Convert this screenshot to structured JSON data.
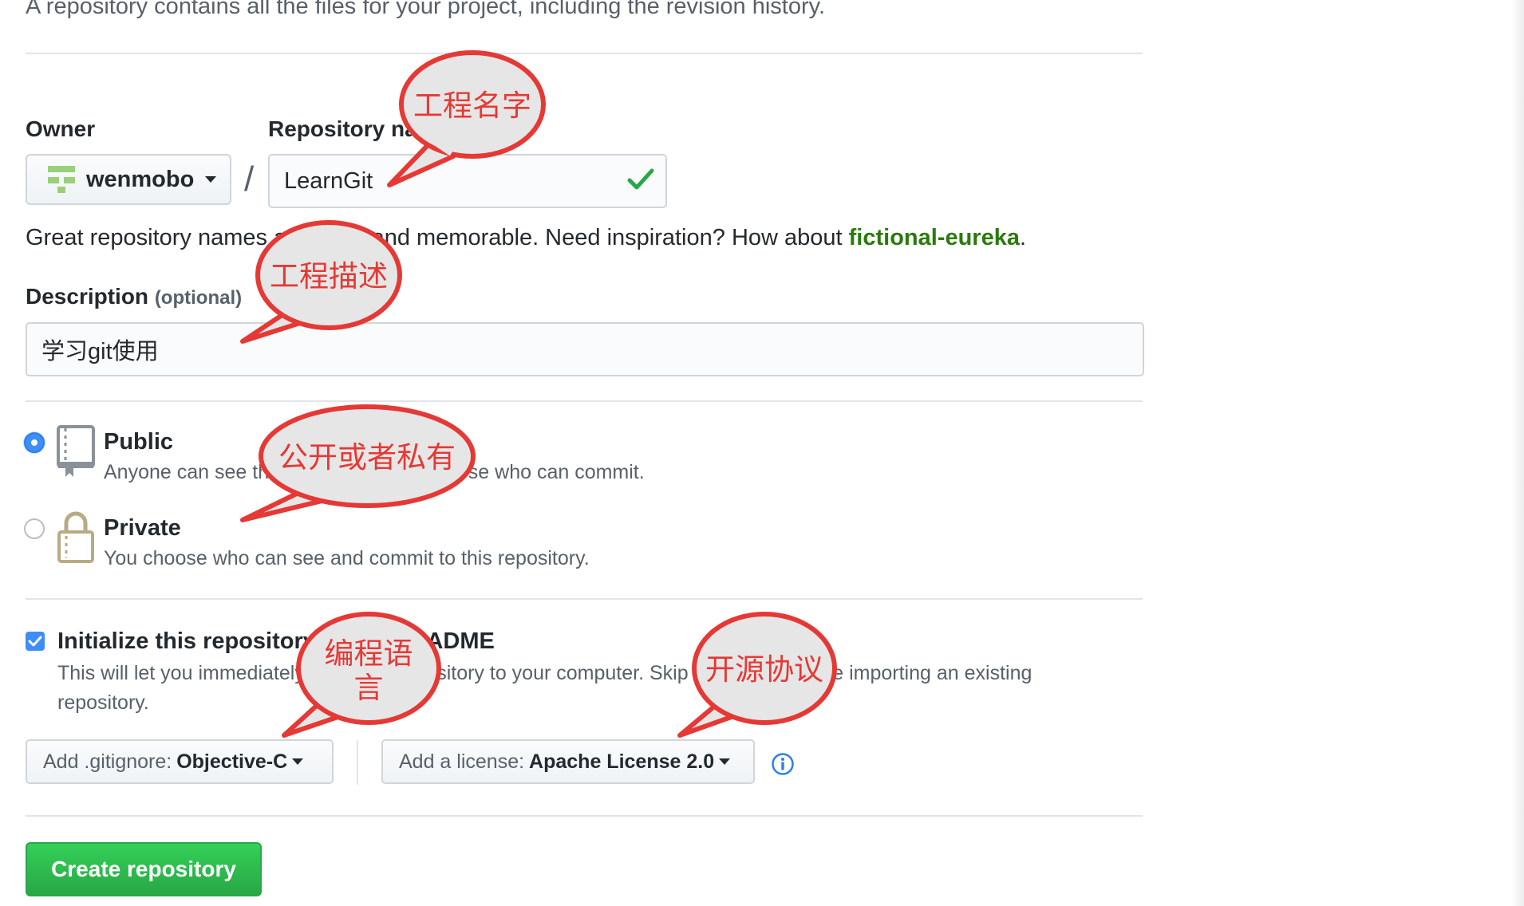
{
  "intro": "A repository contains all the files for your project, including the revision history.",
  "owner": {
    "label": "Owner",
    "name": "wenmobo"
  },
  "repo": {
    "label": "Repository name",
    "value": "LearnGit",
    "valid_icon": "check-icon"
  },
  "hint": {
    "prefix": "Great repository names are short and memorable. Need inspiration? How about ",
    "suggestion": "fictional-eureka",
    "suffix": "."
  },
  "description": {
    "label": "Description",
    "optional": "(optional)",
    "value": "学习git使用"
  },
  "visibility": {
    "public": {
      "title": "Public",
      "sub": "Anyone can see this repository. You choose who can commit.",
      "checked": true
    },
    "private": {
      "title": "Private",
      "sub": "You choose who can see and commit to this repository.",
      "checked": false
    }
  },
  "init": {
    "title": "Initialize this repository with a README",
    "sub": "This will let you immediately clone the repository to your computer. Skip this step if you’re importing an existing repository.",
    "checked": true
  },
  "gitignore": {
    "prefix": "Add .gitignore:",
    "value": "Objective-C"
  },
  "license": {
    "prefix": "Add a license:",
    "value": "Apache License 2.0"
  },
  "create_button": "Create repository",
  "callouts": {
    "repo_name": "工程名字",
    "description": "工程描述",
    "visibility": "公开或者私有",
    "language_line1": "编程语",
    "language_line2": "言",
    "license": "开源协议"
  },
  "colors": {
    "accent": "#2b7a0b",
    "primary_button": "#28a745",
    "callout_border": "#e53935",
    "checkbox": "#3e8ef7"
  }
}
